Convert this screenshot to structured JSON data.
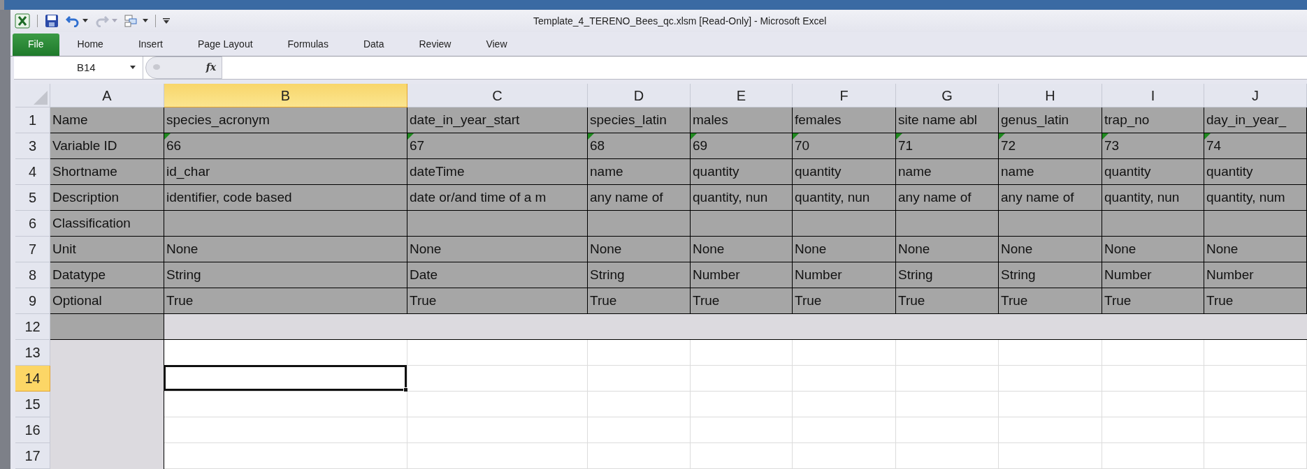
{
  "window": {
    "title": "Template_4_TERENO_Bees_qc.xlsm  [Read-Only]  -  Microsoft Excel"
  },
  "quick_access": [
    {
      "kind": "save"
    },
    {
      "kind": "undo",
      "disabled": false
    },
    {
      "kind": "redo",
      "disabled": true
    },
    {
      "kind": "form"
    }
  ],
  "ribbon_tabs": [
    {
      "label": "File",
      "kind": "file"
    },
    {
      "label": "Home",
      "kind": "tab"
    },
    {
      "label": "Insert",
      "kind": "tab"
    },
    {
      "label": "Page Layout",
      "kind": "tab"
    },
    {
      "label": "Formulas",
      "kind": "tab"
    },
    {
      "label": "Data",
      "kind": "tab"
    },
    {
      "label": "Review",
      "kind": "tab"
    },
    {
      "label": "View",
      "kind": "tab"
    }
  ],
  "formula_bar": {
    "name_box": "B14",
    "fx": "fx"
  },
  "columns": [
    {
      "label": "A",
      "selected": false
    },
    {
      "label": "B",
      "selected": true
    },
    {
      "label": "C",
      "selected": false
    },
    {
      "label": "D",
      "selected": false
    },
    {
      "label": "E",
      "selected": false
    },
    {
      "label": "F",
      "selected": false
    },
    {
      "label": "G",
      "selected": false
    },
    {
      "label": "H",
      "selected": false
    },
    {
      "label": "I",
      "selected": false
    },
    {
      "label": "J",
      "selected": false
    }
  ],
  "rows": [
    {
      "number": "1",
      "kind": "data",
      "selected": false,
      "cells": [
        "Name",
        "species_acronym",
        "date_in_year_start",
        "species_latin",
        "males",
        "females",
        "site name abl",
        "genus_latin",
        "trap_no",
        "day_in_year_"
      ]
    },
    {
      "number": "3",
      "kind": "data",
      "selected": false,
      "error_marks": true,
      "cells": [
        "Variable ID",
        "66",
        "67",
        "68",
        "69",
        "70",
        "71",
        "72",
        "73",
        "74"
      ]
    },
    {
      "number": "4",
      "kind": "data",
      "selected": false,
      "cells": [
        "Shortname",
        "id_char",
        "dateTime",
        "name",
        "quantity",
        "quantity",
        "name",
        "name",
        "quantity",
        "quantity"
      ]
    },
    {
      "number": "5",
      "kind": "data",
      "selected": false,
      "cells": [
        "Description",
        "identifier, code based",
        "date or/and time of a m",
        "any name of",
        "quantity, nun",
        "quantity, nun",
        "any name of",
        "any name of",
        "quantity, nun",
        "quantity, num"
      ]
    },
    {
      "number": "6",
      "kind": "data",
      "selected": false,
      "cells": [
        "Classification"
      ]
    },
    {
      "number": "7",
      "kind": "data",
      "selected": false,
      "cells": [
        "Unit",
        "None",
        "None",
        "None",
        "None",
        "None",
        "None",
        "None",
        "None",
        "None"
      ]
    },
    {
      "number": "8",
      "kind": "data",
      "selected": false,
      "cells": [
        "Datatype",
        "String",
        "Date",
        "String",
        "Number",
        "Number",
        "String",
        "String",
        "Number",
        "Number"
      ]
    },
    {
      "number": "9",
      "kind": "data",
      "selected": false,
      "cells": [
        "Optional",
        "True",
        "True",
        "True",
        "True",
        "True",
        "True",
        "True",
        "True",
        "True"
      ]
    },
    {
      "number": "12",
      "kind": "separator",
      "selected": false,
      "cells": []
    },
    {
      "number": "13",
      "kind": "empty",
      "selected": false,
      "cells": []
    },
    {
      "number": "14",
      "kind": "empty",
      "selected": true,
      "cells": []
    },
    {
      "number": "15",
      "kind": "empty",
      "selected": false,
      "cells": []
    },
    {
      "number": "16",
      "kind": "empty",
      "selected": false,
      "cells": []
    },
    {
      "number": "17",
      "kind": "empty",
      "selected": false,
      "cells": []
    }
  ]
}
